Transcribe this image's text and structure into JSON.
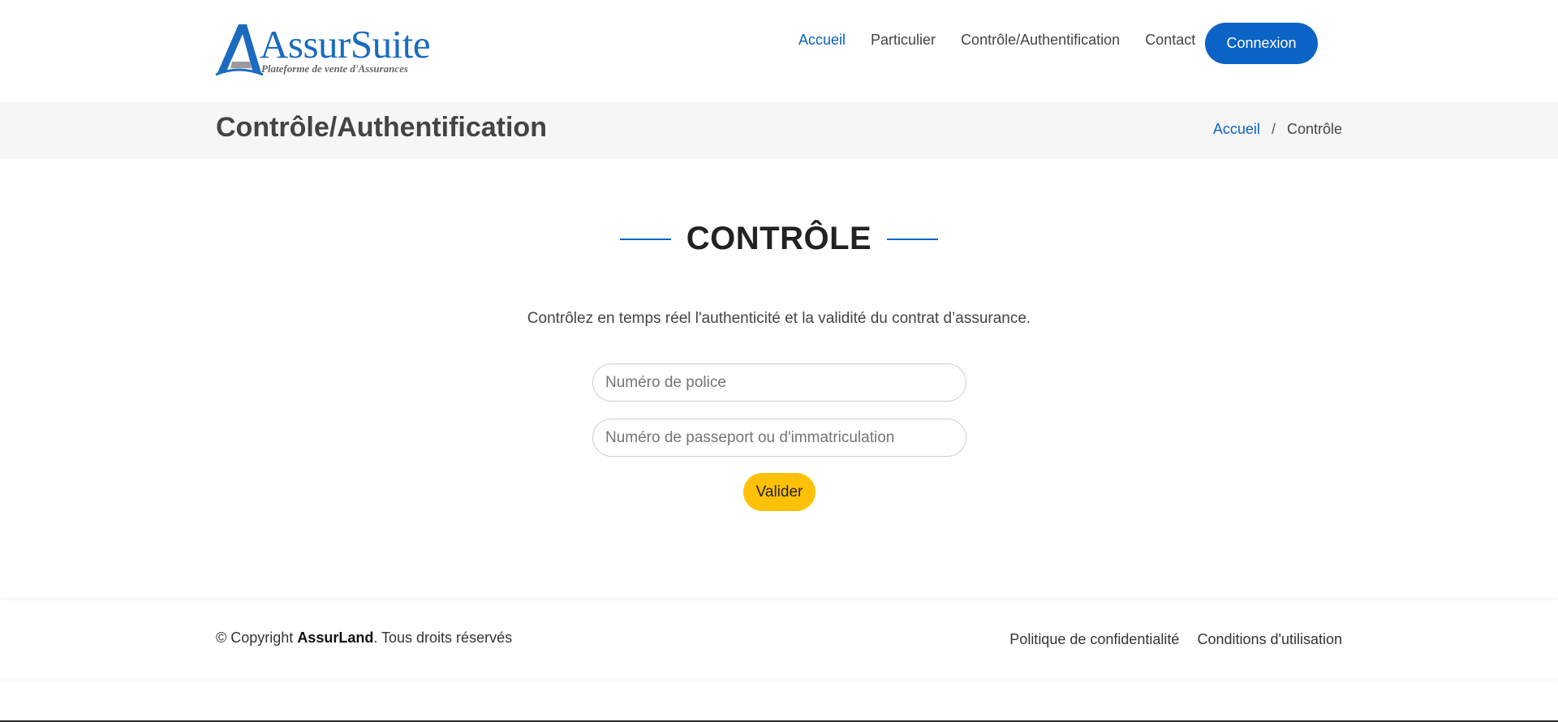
{
  "brand": {
    "name": "AssurSuite",
    "tagline": "Plateforme de vente d'Assurances",
    "color": "#1a6bbf"
  },
  "nav": {
    "items": [
      {
        "label": "Accueil",
        "active": true
      },
      {
        "label": "Particulier",
        "active": false
      },
      {
        "label": "Contrôle/Authentification",
        "active": false
      },
      {
        "label": "Contact",
        "active": false
      }
    ],
    "login_label": "Connexion"
  },
  "page_header": {
    "title": "Contrôle/Authentification",
    "breadcrumb": {
      "home": "Accueil",
      "separator": "/",
      "current": "Contrôle"
    }
  },
  "main": {
    "section_title": "CONTRÔLE",
    "intro": "Contrôlez en temps réel l'authenticité et la validité du contrat d’assurance.",
    "fields": {
      "policy": {
        "placeholder": "Numéro de police",
        "value": ""
      },
      "passport": {
        "placeholder": "Numéro de passeport ou d'immatriculation",
        "value": ""
      }
    },
    "submit_label": "Valider"
  },
  "footer": {
    "copyright_prefix": "© Copyright ",
    "company": "AssurLand",
    "copyright_suffix": ". Tous droits réservés",
    "links": [
      "Politique de confidentialité",
      "Conditions d'utilisation"
    ]
  },
  "colors": {
    "primary": "#0b63c5",
    "accent": "#ffc107",
    "band": "#f6f6f6"
  }
}
